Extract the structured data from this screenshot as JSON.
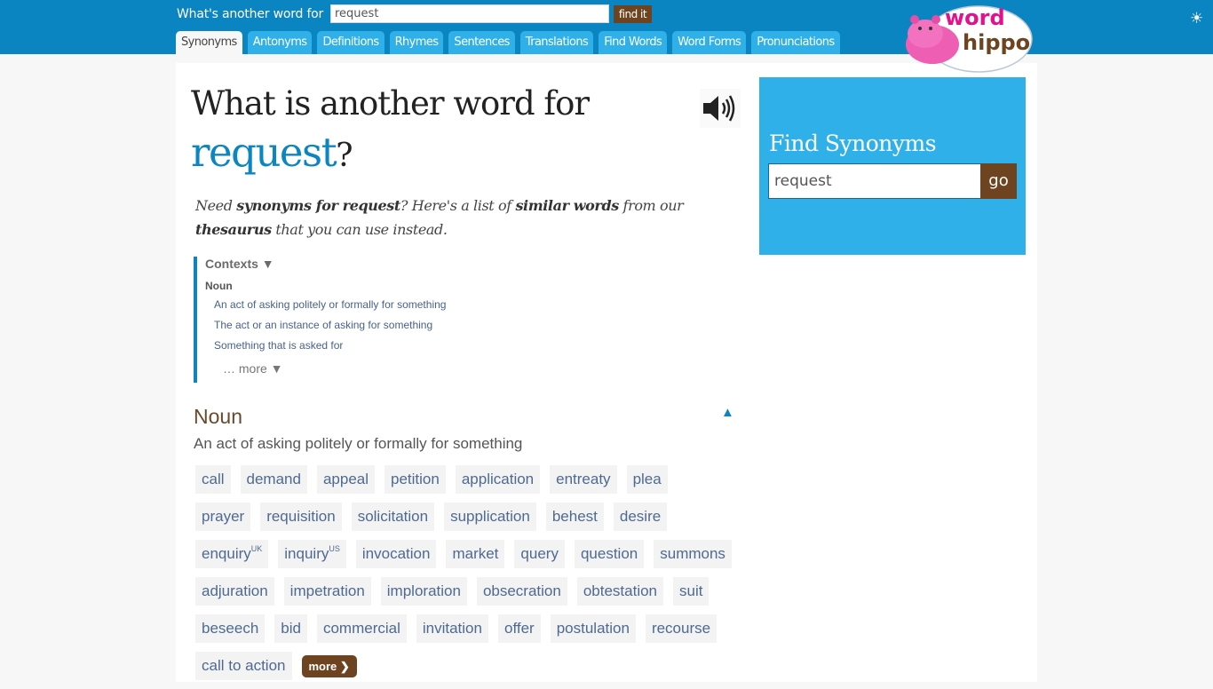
{
  "header": {
    "search_label": "What's another word for",
    "search_value": "request",
    "search_button": "find it",
    "tabs": [
      {
        "label": "Synonyms",
        "active": true
      },
      {
        "label": "Antonyms"
      },
      {
        "label": "Definitions"
      },
      {
        "label": "Rhymes"
      },
      {
        "label": "Sentences"
      },
      {
        "label": "Translations"
      },
      {
        "label": "Find Words"
      },
      {
        "label": "Word Forms"
      },
      {
        "label": "Pronunciations"
      }
    ],
    "logo": {
      "word": "word",
      "hippo": "hippo"
    },
    "brightness_icon": "☀"
  },
  "main": {
    "title_prefix": "What is another word for",
    "word": "request",
    "title_suffix": "?",
    "intro": {
      "p1": "Need ",
      "b1": "synonyms for request",
      "p2": "? Here's a list of ",
      "b2": "similar words",
      "p3": " from our ",
      "b3": "thesaurus",
      "p4": " that you can use instead."
    },
    "contexts": {
      "heading": "Contexts ▼",
      "pos": "Noun",
      "items": [
        "An act of asking politely or formally for something",
        "The act or an instance of asking for something",
        "Something that is asked for"
      ],
      "more": "… more ▼"
    },
    "section": {
      "title": "Noun",
      "collapse_icon": "▲",
      "definition": "An act of asking politely or formally for something",
      "rows": [
        [
          {
            "w": "call"
          },
          {
            "w": "demand"
          },
          {
            "w": "appeal"
          },
          {
            "w": "petition"
          },
          {
            "w": "application"
          },
          {
            "w": "entreaty"
          },
          {
            "w": "plea"
          }
        ],
        [
          {
            "w": "prayer"
          },
          {
            "w": "requisition"
          },
          {
            "w": "solicitation"
          },
          {
            "w": "supplication"
          },
          {
            "w": "behest"
          },
          {
            "w": "desire"
          }
        ],
        [
          {
            "w": "enquiry",
            "sup": "UK"
          },
          {
            "w": "inquiry",
            "sup": "US"
          },
          {
            "w": "invocation"
          },
          {
            "w": "market"
          },
          {
            "w": "query"
          },
          {
            "w": "question"
          },
          {
            "w": "summons"
          }
        ],
        [
          {
            "w": "adjuration"
          },
          {
            "w": "impetration"
          },
          {
            "w": "imploration"
          },
          {
            "w": "obsecration"
          },
          {
            "w": "obtestation"
          },
          {
            "w": "suit"
          }
        ],
        [
          {
            "w": "beseech"
          },
          {
            "w": "bid"
          },
          {
            "w": "commercial"
          },
          {
            "w": "invitation"
          },
          {
            "w": "offer"
          },
          {
            "w": "postulation"
          },
          {
            "w": "recourse"
          }
        ],
        [
          {
            "w": "call to action"
          }
        ]
      ],
      "more_button": "more ❯"
    }
  },
  "sidebar": {
    "title": "Find Synonyms",
    "input_value": "request",
    "go_label": "go"
  },
  "colors": {
    "header_blue": "#0a85c2",
    "tab_blue": "#2fb0e8",
    "brown": "#6e4420",
    "chip_text": "#4e6a91"
  }
}
